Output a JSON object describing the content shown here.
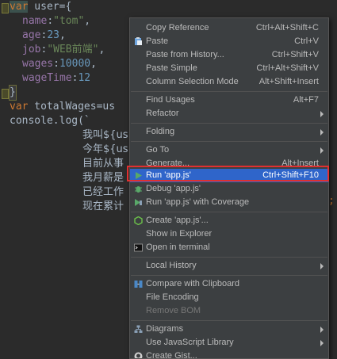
{
  "editor": {
    "lines": [
      {
        "kw": "var",
        "rest": " user={"
      },
      {
        "prop": "name",
        "punc": ":",
        "str": "\"tom\"",
        "end": ","
      },
      {
        "prop": "age",
        "punc": ":",
        "num": "23",
        "end": ","
      },
      {
        "prop": "job",
        "punc": ":",
        "str": "\"WEB前端\"",
        "end": ","
      },
      {
        "prop": "wages",
        "punc": ":",
        "num": "10000",
        "end": ","
      },
      {
        "prop": "wageTime",
        "punc": ":",
        "num": "12",
        "end": ""
      },
      {
        "text": "}"
      },
      {
        "kw": "var",
        "rest": " totalWages=us"
      },
      {
        "text": "console.log(`"
      },
      {
        "cn": "我叫${us"
      },
      {
        "cn": "今年${us"
      },
      {
        "cn": "目前从事"
      },
      {
        "cn": "我月薪是"
      },
      {
        "cn": "已经工作"
      },
      {
        "cn": "现在累计",
        "tail": ";"
      }
    ]
  },
  "menu": {
    "items": {
      "copy_reference": {
        "label": "Copy Reference",
        "shortcut": "Ctrl+Alt+Shift+C"
      },
      "paste": {
        "label": "Paste",
        "shortcut": "Ctrl+V",
        "icon": "clipboard-icon"
      },
      "paste_history": {
        "label": "Paste from History...",
        "shortcut": "Ctrl+Shift+V"
      },
      "paste_simple": {
        "label": "Paste Simple",
        "shortcut": "Ctrl+Alt+Shift+V"
      },
      "column_selection": {
        "label": "Column Selection Mode",
        "shortcut": "Alt+Shift+Insert"
      },
      "find_usages": {
        "label": "Find Usages",
        "shortcut": "Alt+F7"
      },
      "refactor": {
        "label": "Refactor"
      },
      "folding": {
        "label": "Folding"
      },
      "goto": {
        "label": "Go To"
      },
      "generate": {
        "label": "Generate...",
        "shortcut": "Alt+Insert"
      },
      "run": {
        "label": "Run 'app.js'",
        "shortcut": "Ctrl+Shift+F10",
        "icon": "run-icon"
      },
      "debug": {
        "label": "Debug 'app.js'",
        "icon": "debug-icon"
      },
      "run_coverage": {
        "label": "Run 'app.js' with Coverage",
        "icon": "coverage-icon"
      },
      "create": {
        "label": "Create 'app.js'...",
        "icon": "nodejs-icon"
      },
      "show_explorer": {
        "label": "Show in Explorer"
      },
      "open_terminal": {
        "label": "Open in terminal",
        "icon": "terminal-icon"
      },
      "local_history": {
        "label": "Local History"
      },
      "compare_clipboard": {
        "label": "Compare with Clipboard",
        "icon": "compare-icon"
      },
      "file_encoding": {
        "label": "File Encoding"
      },
      "remove_bom": {
        "label": "Remove BOM"
      },
      "diagrams": {
        "label": "Diagrams",
        "icon": "diagram-icon"
      },
      "js_library": {
        "label": "Use JavaScript Library"
      },
      "create_gist": {
        "label": "Create Gist...",
        "icon": "github-icon"
      }
    }
  },
  "colors": {
    "selection": "#2f65ca",
    "highlight_outline": "#e03030",
    "menu_bg": "#3c3f41",
    "editor_bg": "#2b2b2b"
  }
}
